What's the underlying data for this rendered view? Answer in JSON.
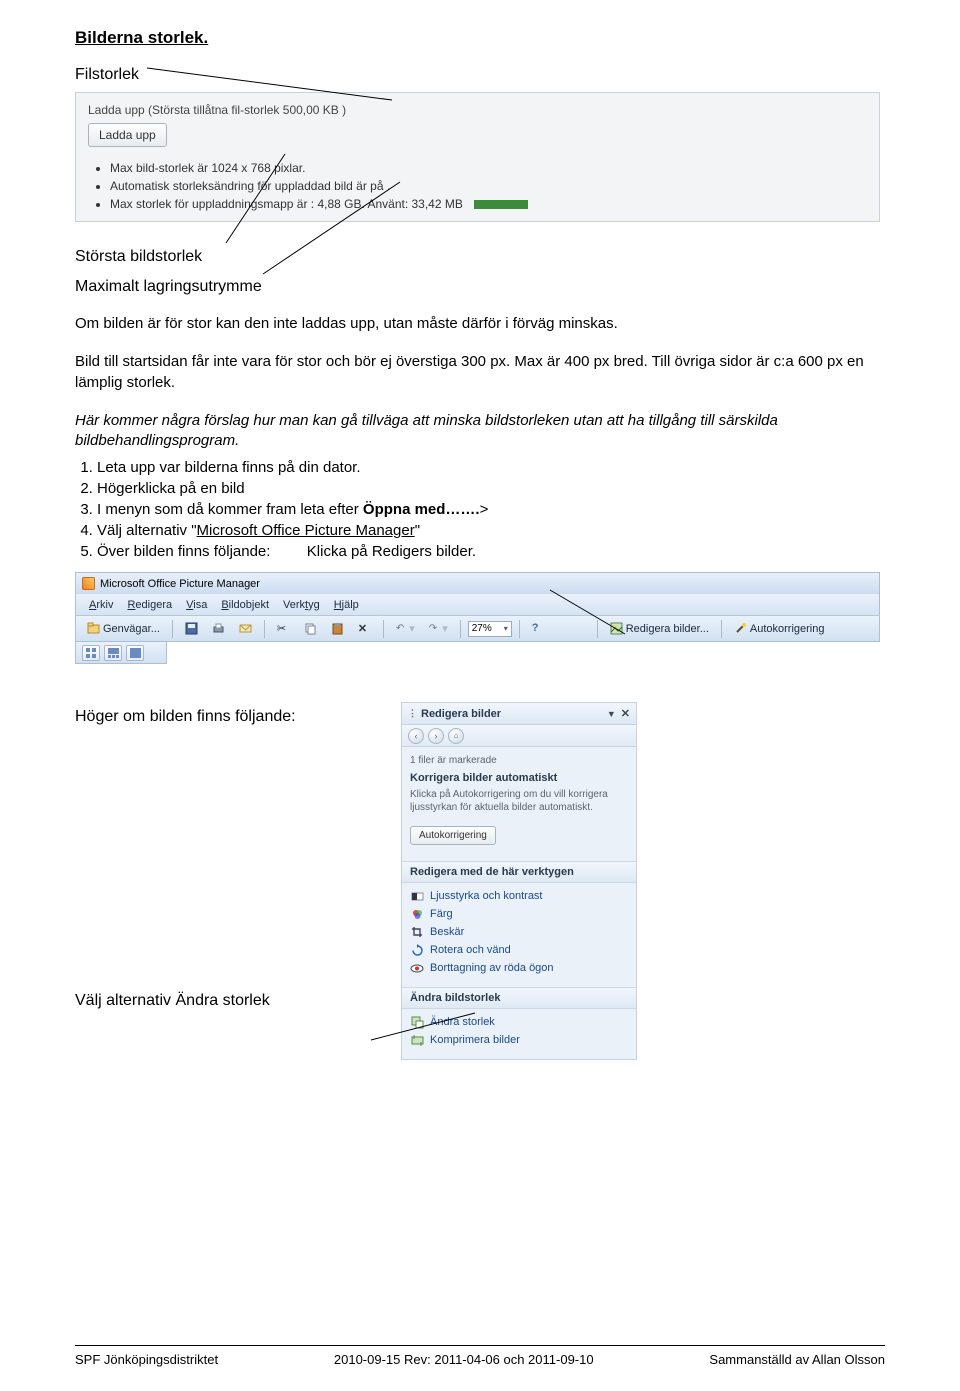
{
  "heading": "Bilderna storlek.",
  "labels": {
    "filstorlek": "Filstorlek",
    "storsta": "Största bildstorlek",
    "maxlagring": "Maximalt lagringsutrymme",
    "hogerOm": "Höger om bilden finns följande:",
    "valjAndra": "Välj alternativ Ändra storlek"
  },
  "upload": {
    "title": "Ladda upp (Största tillåtna fil-storlek 500,00 KB )",
    "button": "Ladda upp",
    "bullets": [
      "Max bild-storlek är 1024 x 768 pixlar.",
      "Automatisk storleksändring för uppladdad bild är på .",
      "Max storlek för uppladdningsmapp är : 4,88 GB. Använt: 33,42 MB"
    ]
  },
  "para1": "Om bilden är för stor kan den inte laddas upp, utan måste därför i förväg minskas.",
  "para2": "Bild till startsidan får inte vara för stor och bör ej överstiga 300 px. Max är 400 px bred. Till övriga sidor är c:a 600 px en lämplig storlek.",
  "para3": "Här kommer några förslag hur man kan gå tillväga att minska bildstorleken utan att ha tillgång till särskilda bildbehandlingsprogram.",
  "steps": {
    "s1": "Leta upp var bilderna finns på din dator.",
    "s2": "Högerklicka på en bild",
    "s3a": "I menyn som då kommer fram leta efter ",
    "s3b": "Öppna med…….",
    "s3c": ">",
    "s4a": "Välj alternativ \"",
    "s4b": "Microsoft Office Picture Manager",
    "s4c": "\"",
    "s5a": "Över bilden finns följande:",
    "s5b": "Klicka på Redigers bilder."
  },
  "mopm": {
    "title": "Microsoft Office Picture Manager",
    "menus": [
      "Arkiv",
      "Redigera",
      "Visa",
      "Bildobjekt",
      "Verktyg",
      "Hjälp"
    ],
    "genvagar": "Genvägar...",
    "zoom": "27%",
    "redigera": "Redigera bilder...",
    "autokorr": "Autokorrigering"
  },
  "sidepanel": {
    "title": "Redigera bilder",
    "marked": "1 filer är markerade",
    "section1": "Korrigera bilder automatiskt",
    "desc1": "Klicka på Autokorrigering om du vill korrigera ljusstyrkan för aktuella bilder automatiskt.",
    "autobtn": "Autokorrigering",
    "section2": "Redigera med de här verktygen",
    "tools": [
      "Ljusstyrka och kontrast",
      "Färg",
      "Beskär",
      "Rotera och vänd",
      "Borttagning av röda ögon"
    ],
    "section3": "Ändra bildstorlek",
    "size_tools": [
      "Ändra storlek",
      "Komprimera bilder"
    ]
  },
  "footer": {
    "left": "SPF Jönköpingsdistriktet",
    "center": "2010-09-15 Rev: 2011-04-06 och 2011-09-10",
    "right": "Sammanställd av Allan Olsson"
  }
}
